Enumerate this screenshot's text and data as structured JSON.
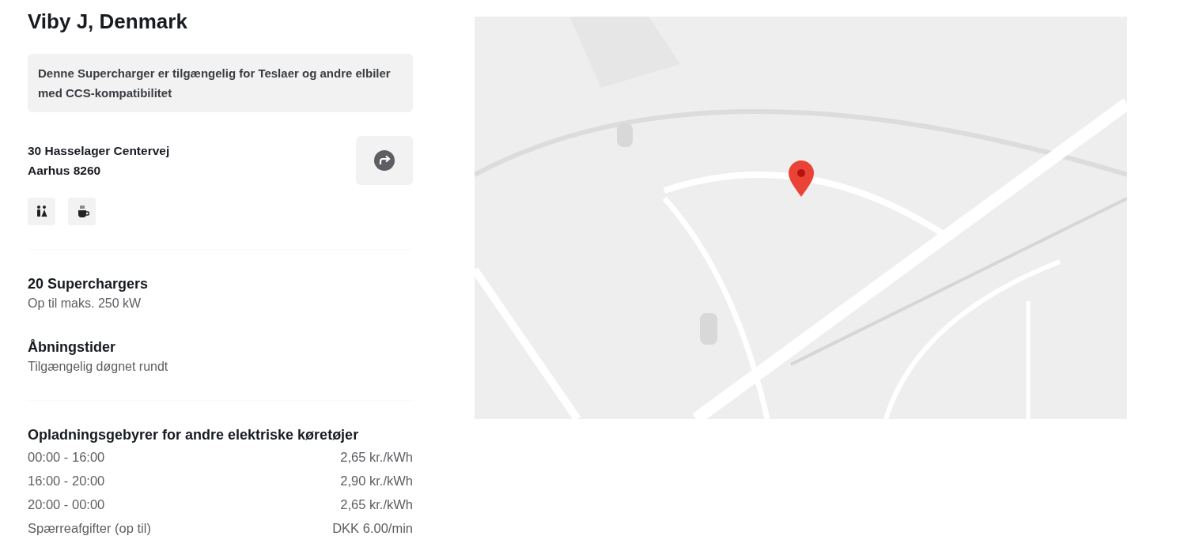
{
  "location": {
    "title": "Viby J, Denmark"
  },
  "notice": "Denne Supercharger er tilgængelig for Teslaer og andre elbiler med CCS-kompatibilitet",
  "address": {
    "street": "30 Hasselager Centervej",
    "city": "Aarhus 8260"
  },
  "amenities": [
    {
      "kind": "restroom"
    },
    {
      "kind": "cafe"
    }
  ],
  "sections": [
    {
      "heading": "20 Superchargers",
      "text": "Op til maks. 250 kW"
    },
    {
      "heading": "Åbningstider",
      "text": "Tilgængelig døgnet rundt"
    }
  ],
  "fees": {
    "heading": "Opladningsgebyrer for andre elektriske køretøjer",
    "rows": [
      {
        "label": "00:00 - 16:00",
        "value": "2,65 kr./kWh"
      },
      {
        "label": "16:00 - 20:00",
        "value": "2,90 kr./kWh"
      },
      {
        "label": "20:00 - 00:00",
        "value": "2,65 kr./kWh"
      },
      {
        "label": "Spærreafgifter (op til)",
        "value": "DKK 6.00/min"
      }
    ]
  }
}
